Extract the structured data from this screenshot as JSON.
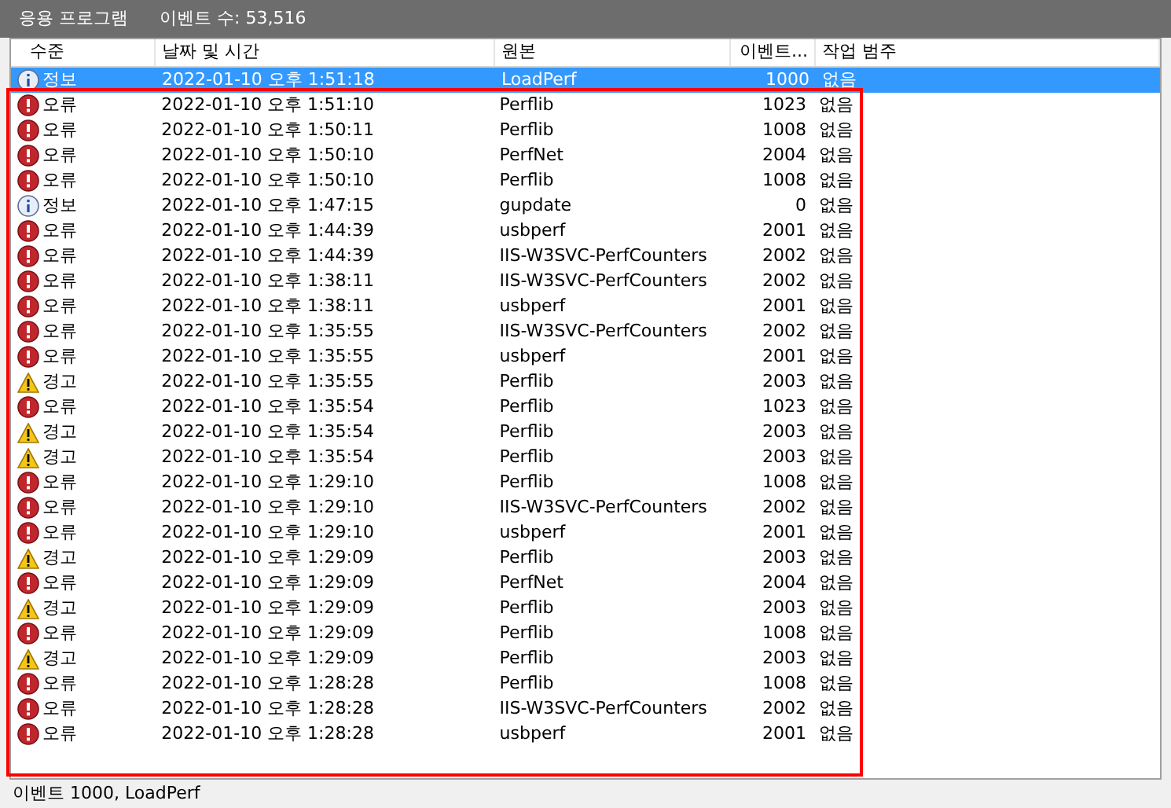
{
  "title_bar": {
    "log_name": "응용 프로그램",
    "event_count": "이벤트 수: 53,516"
  },
  "table": {
    "columns": [
      "수준",
      "날짜 및 시간",
      "원본",
      "이벤트...",
      "작업 범주"
    ],
    "rows": [
      {
        "kind": "info",
        "level": "정보",
        "date": "2022-01-10 오후 1:51:18",
        "source": "LoadPerf",
        "event_id": "1000",
        "category": "없음",
        "selected": true
      },
      {
        "kind": "error",
        "level": "오류",
        "date": "2022-01-10 오후 1:51:10",
        "source": "Perflib",
        "event_id": "1023",
        "category": "없음",
        "selected": false
      },
      {
        "kind": "error",
        "level": "오류",
        "date": "2022-01-10 오후 1:50:11",
        "source": "Perflib",
        "event_id": "1008",
        "category": "없음",
        "selected": false
      },
      {
        "kind": "error",
        "level": "오류",
        "date": "2022-01-10 오후 1:50:10",
        "source": "PerfNet",
        "event_id": "2004",
        "category": "없음",
        "selected": false
      },
      {
        "kind": "error",
        "level": "오류",
        "date": "2022-01-10 오후 1:50:10",
        "source": "Perflib",
        "event_id": "1008",
        "category": "없음",
        "selected": false
      },
      {
        "kind": "info",
        "level": "정보",
        "date": "2022-01-10 오후 1:47:15",
        "source": "gupdate",
        "event_id": "0",
        "category": "없음",
        "selected": false
      },
      {
        "kind": "error",
        "level": "오류",
        "date": "2022-01-10 오후 1:44:39",
        "source": "usbperf",
        "event_id": "2001",
        "category": "없음",
        "selected": false
      },
      {
        "kind": "error",
        "level": "오류",
        "date": "2022-01-10 오후 1:44:39",
        "source": "IIS-W3SVC-PerfCounters",
        "event_id": "2002",
        "category": "없음",
        "selected": false
      },
      {
        "kind": "error",
        "level": "오류",
        "date": "2022-01-10 오후 1:38:11",
        "source": "IIS-W3SVC-PerfCounters",
        "event_id": "2002",
        "category": "없음",
        "selected": false
      },
      {
        "kind": "error",
        "level": "오류",
        "date": "2022-01-10 오후 1:38:11",
        "source": "usbperf",
        "event_id": "2001",
        "category": "없음",
        "selected": false
      },
      {
        "kind": "error",
        "level": "오류",
        "date": "2022-01-10 오후 1:35:55",
        "source": "IIS-W3SVC-PerfCounters",
        "event_id": "2002",
        "category": "없음",
        "selected": false
      },
      {
        "kind": "error",
        "level": "오류",
        "date": "2022-01-10 오후 1:35:55",
        "source": "usbperf",
        "event_id": "2001",
        "category": "없음",
        "selected": false
      },
      {
        "kind": "warning",
        "level": "경고",
        "date": "2022-01-10 오후 1:35:55",
        "source": "Perflib",
        "event_id": "2003",
        "category": "없음",
        "selected": false
      },
      {
        "kind": "error",
        "level": "오류",
        "date": "2022-01-10 오후 1:35:54",
        "source": "Perflib",
        "event_id": "1023",
        "category": "없음",
        "selected": false
      },
      {
        "kind": "warning",
        "level": "경고",
        "date": "2022-01-10 오후 1:35:54",
        "source": "Perflib",
        "event_id": "2003",
        "category": "없음",
        "selected": false
      },
      {
        "kind": "warning",
        "level": "경고",
        "date": "2022-01-10 오후 1:35:54",
        "source": "Perflib",
        "event_id": "2003",
        "category": "없음",
        "selected": false
      },
      {
        "kind": "error",
        "level": "오류",
        "date": "2022-01-10 오후 1:29:10",
        "source": "Perflib",
        "event_id": "1008",
        "category": "없음",
        "selected": false
      },
      {
        "kind": "error",
        "level": "오류",
        "date": "2022-01-10 오후 1:29:10",
        "source": "IIS-W3SVC-PerfCounters",
        "event_id": "2002",
        "category": "없음",
        "selected": false
      },
      {
        "kind": "error",
        "level": "오류",
        "date": "2022-01-10 오후 1:29:10",
        "source": "usbperf",
        "event_id": "2001",
        "category": "없음",
        "selected": false
      },
      {
        "kind": "warning",
        "level": "경고",
        "date": "2022-01-10 오후 1:29:09",
        "source": "Perflib",
        "event_id": "2003",
        "category": "없음",
        "selected": false
      },
      {
        "kind": "error",
        "level": "오류",
        "date": "2022-01-10 오후 1:29:09",
        "source": "PerfNet",
        "event_id": "2004",
        "category": "없음",
        "selected": false
      },
      {
        "kind": "warning",
        "level": "경고",
        "date": "2022-01-10 오후 1:29:09",
        "source": "Perflib",
        "event_id": "2003",
        "category": "없음",
        "selected": false
      },
      {
        "kind": "error",
        "level": "오류",
        "date": "2022-01-10 오후 1:29:09",
        "source": "Perflib",
        "event_id": "1008",
        "category": "없음",
        "selected": false
      },
      {
        "kind": "warning",
        "level": "경고",
        "date": "2022-01-10 오후 1:29:09",
        "source": "Perflib",
        "event_id": "2003",
        "category": "없음",
        "selected": false
      },
      {
        "kind": "error",
        "level": "오류",
        "date": "2022-01-10 오후 1:28:28",
        "source": "Perflib",
        "event_id": "1008",
        "category": "없음",
        "selected": false
      },
      {
        "kind": "error",
        "level": "오류",
        "date": "2022-01-10 오후 1:28:28",
        "source": "IIS-W3SVC-PerfCounters",
        "event_id": "2002",
        "category": "없음",
        "selected": false
      },
      {
        "kind": "error",
        "level": "오류",
        "date": "2022-01-10 오후 1:28:28",
        "source": "usbperf",
        "event_id": "2001",
        "category": "없음",
        "selected": false
      }
    ]
  },
  "status_bar": {
    "text": "이벤트 1000, LoadPerf"
  }
}
